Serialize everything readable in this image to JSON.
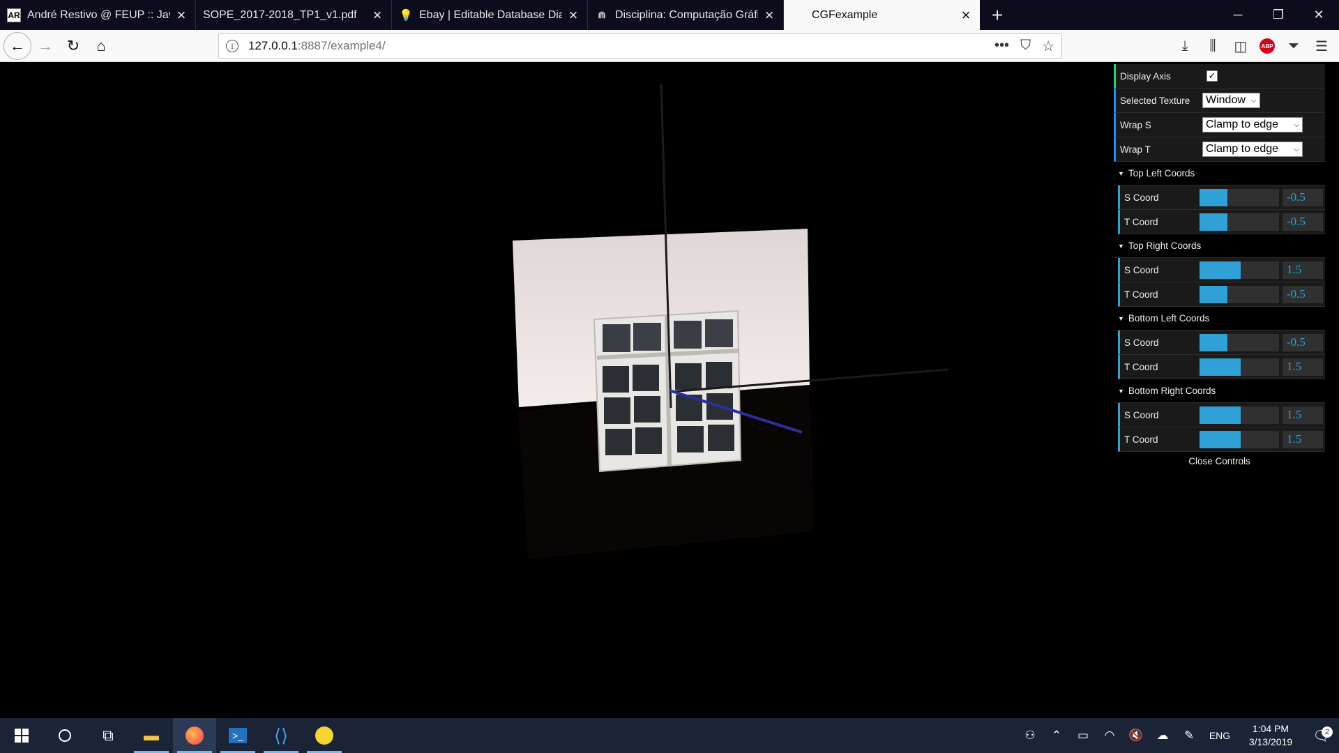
{
  "browser": {
    "tabs": [
      {
        "favicon": "AR",
        "title": "André Restivo @ FEUP :: Java / I"
      },
      {
        "favicon": "",
        "title": "SOPE_2017-2018_TP1_v1.pdf"
      },
      {
        "favicon": "lightbulb-icon",
        "title": "Ebay | Editable Database Diagr"
      },
      {
        "favicon": "sigarra-icon",
        "title": "Disciplina: Computação Gráfica"
      },
      {
        "favicon": "",
        "title": "CGFexample"
      }
    ],
    "active_tab_index": 4,
    "url": {
      "host": "127.0.0.1",
      "path": ":8887/example4/"
    }
  },
  "gui": {
    "display_axis": {
      "label": "Display Axis",
      "checked": true
    },
    "selected_texture": {
      "label": "Selected Texture",
      "value": "Window"
    },
    "wrap_s": {
      "label": "Wrap S",
      "value": "Clamp to edge"
    },
    "wrap_t": {
      "label": "Wrap T",
      "value": "Clamp to edge"
    },
    "folders": [
      {
        "title": "Top Left Coords",
        "s": {
          "label": "S Coord",
          "value": "-0.5",
          "fraction": 0.35
        },
        "t": {
          "label": "T Coord",
          "value": "-0.5",
          "fraction": 0.35
        }
      },
      {
        "title": "Top Right Coords",
        "s": {
          "label": "S Coord",
          "value": "1.5",
          "fraction": 0.52
        },
        "t": {
          "label": "T Coord",
          "value": "-0.5",
          "fraction": 0.35
        }
      },
      {
        "title": "Bottom Left Coords",
        "s": {
          "label": "S Coord",
          "value": "-0.5",
          "fraction": 0.35
        },
        "t": {
          "label": "T Coord",
          "value": "1.5",
          "fraction": 0.52
        }
      },
      {
        "title": "Bottom Right Coords",
        "s": {
          "label": "S Coord",
          "value": "1.5",
          "fraction": 0.52
        },
        "t": {
          "label": "T Coord",
          "value": "1.5",
          "fraction": 0.52
        }
      }
    ],
    "close_label": "Close Controls"
  },
  "taskbar": {
    "language": "ENG",
    "time": "1:04 PM",
    "date": "3/13/2019",
    "notification_count": "2"
  },
  "colors": {
    "slider_fill": "#2fa1d6",
    "accent": "#1ed36f",
    "taskbar": "#1a2436"
  }
}
